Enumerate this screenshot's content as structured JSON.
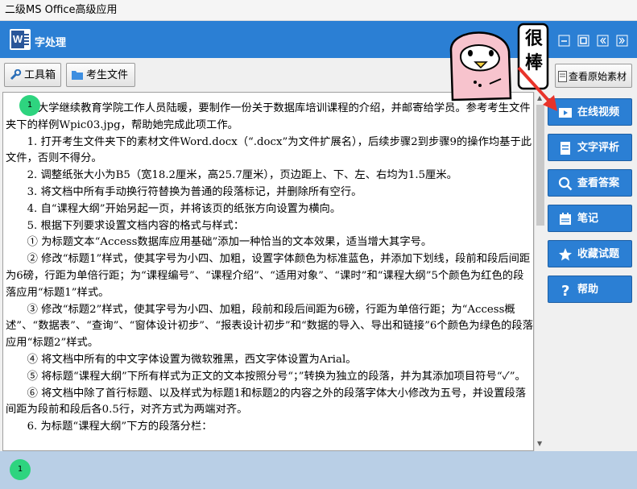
{
  "window": {
    "title": "二级MS Office高级应用"
  },
  "app": {
    "title": "字处理"
  },
  "toolbar": {
    "toolbox_label": "工具箱",
    "folder_label": "考生文件夹",
    "view_material_label": "查看原始素材"
  },
  "sticker": {
    "text": "很棒"
  },
  "sidebar": {
    "items": [
      {
        "label": "在线视频",
        "icon": "video-icon"
      },
      {
        "label": "文字评析",
        "icon": "document-icon"
      },
      {
        "label": "查看答案",
        "icon": "search-icon"
      },
      {
        "label": "笔记",
        "icon": "calendar-icon"
      },
      {
        "label": "收藏试题",
        "icon": "star-icon"
      },
      {
        "label": "帮助",
        "icon": "question-icon"
      }
    ]
  },
  "badges": {
    "top": "1",
    "bottom": "1"
  },
  "document": {
    "paragraphs": [
      "　　某大学继续教育学院工作人员陆暖，要制作一份关于数据库培训课程的介绍，并邮寄给学员。参考考生文件夹下的样例Wpic03.jpg，帮助她完成此项工作。",
      "　　1. 打开考生文件夹下的素材文件Word.docx（“.docx”为文件扩展名），后续步骤2到步骤9的操作均基于此文件，否则不得分。",
      "　　2. 调整纸张大小为B5（宽18.2厘米，高25.7厘米），页边距上、下、左、右均为1.5厘米。",
      "　　3. 将文档中所有手动换行符替换为普通的段落标记，并删除所有空行。",
      "　　4. 自“课程大纲”开始另起一页，并将该页的纸张方向设置为横向。",
      "　　5. 根据下列要求设置文档内容的格式与样式：",
      "　　① 为标题文本“Access数据库应用基础”添加一种恰当的文本效果，适当增大其字号。",
      "　　② 修改“标题1”样式，使其字号为小四、加粗，设置字体颜色为标准蓝色，并添加下划线，段前和段后间距为6磅，行距为单倍行距；为“课程编号”、“课程介绍”、“适用对象”、“课时”和“课程大纲”5个颜色为红色的段落应用“标题1”样式。",
      "　　③ 修改“标题2”样式，使其字号为小四、加粗，段前和段后间距为6磅，行距为单倍行距；为“Access概述”、“数据表”、“查询”、“窗体设计初步”、“报表设计初步”和“数据的导入、导出和链接”6个颜色为绿色的段落应用“标题2”样式。",
      "　　④ 将文档中所有的中文字体设置为微软雅黑，西文字体设置为Arial。",
      "　　⑤ 将标题“课程大纲”下所有样式为正文的文本按照分号“；”转换为独立的段落，并为其添加项目符号“✓”。",
      "　　⑥ 将文档中除了首行标题、以及样式为标题1和标题2的内容之外的段落字体大小修改为五号，并设置段落间距为段前和段后各0.5行，对齐方式为两端对齐。",
      "　　6. 为标题“课程大纲”下方的段落分栏："
    ]
  },
  "colors": {
    "accent": "#2b7fd4",
    "badge": "#2ed47f",
    "footer": "#b9cfe6",
    "arrow": "#e8332a"
  }
}
